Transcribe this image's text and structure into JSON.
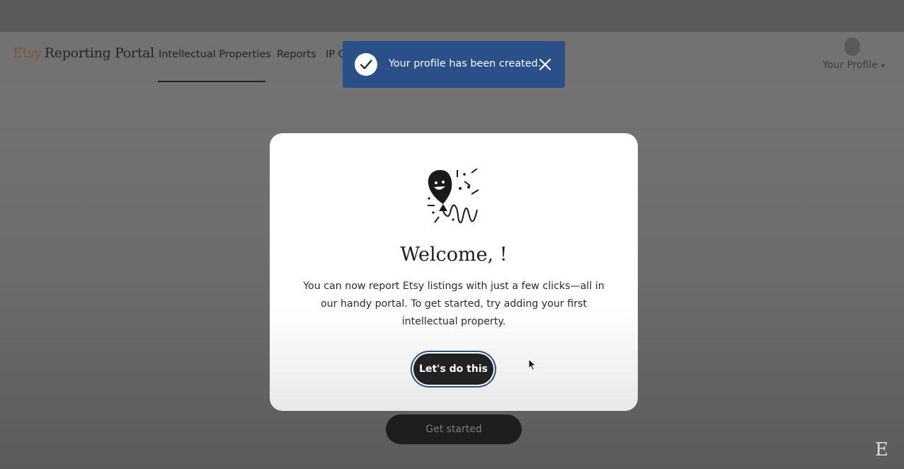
{
  "header": {
    "brand_etsy": "Etsy",
    "brand_portal": "Reporting Portal",
    "nav": [
      "Intellectual Properties",
      "Reports",
      "IP C"
    ],
    "profile_label": "Your Profile",
    "profile_caret": "▾"
  },
  "toast": {
    "message": "Your profile has been created.",
    "icon": "check-circle-icon",
    "close_icon": "close-icon",
    "color": "#2b4f88"
  },
  "modal": {
    "title": "Welcome, !",
    "message": "You can now report Etsy listings with just a few clicks—all in our handy portal. To get started, try adding your first intellectual property.",
    "button_label": "Let's do this",
    "illustration": "balloon-celebration-icon"
  },
  "background": {
    "get_started_label": "Get started",
    "footer_logo": "E"
  }
}
